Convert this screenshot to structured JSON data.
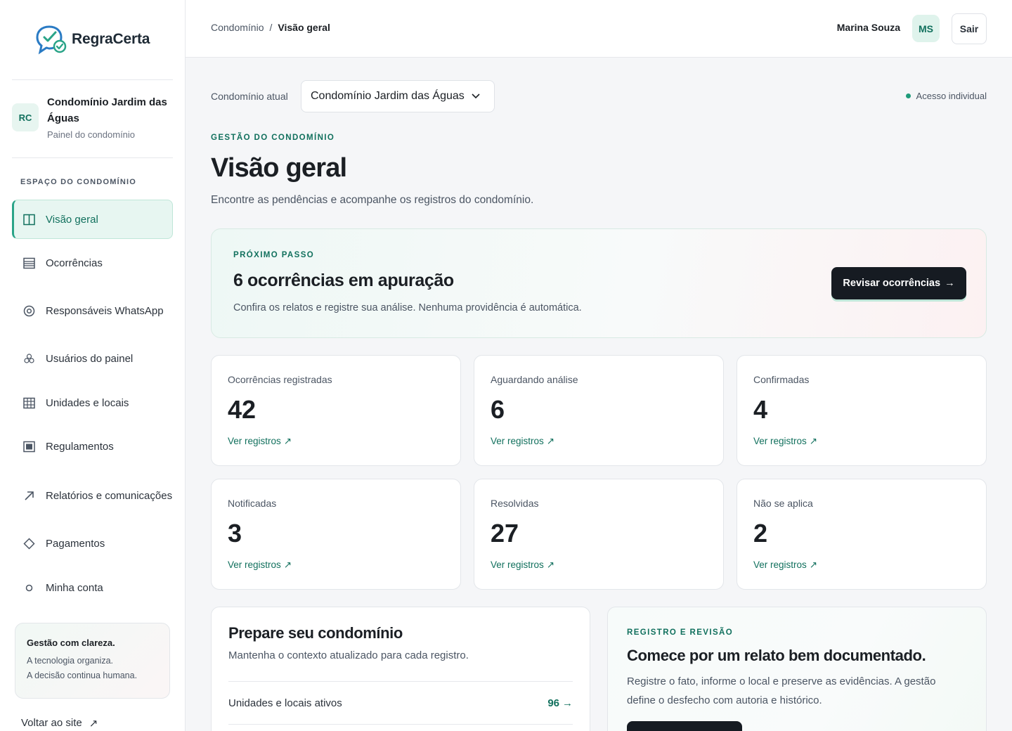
{
  "brand": {
    "name": "RegraCerta",
    "accent": "#11705d",
    "check_color": "#2aa488"
  },
  "condo": {
    "initials": "RC",
    "name": "Condomínio Jardim das Águas",
    "subtitle": "Painel do condomínio"
  },
  "sidebar": {
    "section_label": "ESPAÇO DO CONDOMÍNIO",
    "items": [
      {
        "label": "Visão geral",
        "icon": "columns-icon",
        "active": true
      },
      {
        "label": "Ocorrências",
        "icon": "list-icon"
      },
      {
        "label": "Responsáveis WhatsApp",
        "icon": "target-icon"
      },
      {
        "label": "Usuários do painel",
        "icon": "users-icon"
      },
      {
        "label": "Unidades e locais",
        "icon": "grid-icon"
      },
      {
        "label": "Regulamentos",
        "icon": "book-icon"
      },
      {
        "label": "Relatórios e comunicações",
        "icon": "arrow-up-right-icon"
      },
      {
        "label": "Pagamentos",
        "icon": "diamond-icon"
      },
      {
        "label": "Minha conta",
        "icon": "circle-icon"
      }
    ],
    "tip": {
      "title": "Gestão com clareza.",
      "line1": "A tecnologia organiza.",
      "line2": "A decisão continua humana."
    },
    "back_link": "Voltar ao site"
  },
  "topbar": {
    "breadcrumb": {
      "parent": "Condomínio",
      "separator": "/",
      "current": "Visão geral"
    },
    "user_name": "Marina Souza",
    "user_initials": "MS",
    "logout_label": "Sair"
  },
  "main": {
    "selector_label": "Condomínio atual",
    "selector_value": "Condomínio Jardim das Águas",
    "access_label": "Acesso individual",
    "eyebrow": "GESTÃO DO CONDOMÍNIO",
    "title": "Visão geral",
    "lead": "Encontre as pendências e acompanhe os registros do condomínio.",
    "next_step": {
      "eyebrow": "PRÓXIMO PASSO",
      "title": "6 ocorrências em apuração",
      "description": "Confira os relatos e registre sua análise. Nenhuma providência é automática.",
      "button": "Revisar ocorrências"
    },
    "stats": [
      {
        "label": "Ocorrências registradas",
        "value": "42",
        "link": "Ver registros"
      },
      {
        "label": "Aguardando análise",
        "value": "6",
        "link": "Ver registros"
      },
      {
        "label": "Confirmadas",
        "value": "4",
        "link": "Ver registros"
      },
      {
        "label": "Notificadas",
        "value": "3",
        "link": "Ver registros"
      },
      {
        "label": "Resolvidas",
        "value": "27",
        "link": "Ver registros"
      },
      {
        "label": "Não se aplica",
        "value": "2",
        "link": "Ver registros"
      }
    ],
    "prepare": {
      "title": "Prepare seu condomínio",
      "subtitle": "Mantenha o contexto atualizado para cada registro.",
      "rows": [
        {
          "label": "Unidades e locais ativos",
          "value": "96"
        }
      ]
    },
    "documented": {
      "eyebrow": "REGISTRO E REVISÃO",
      "title": "Comece por um relato bem documentado.",
      "description": "Registre o fato, informe o local e preserve as evidências. A gestão define o desfecho com autoria e histórico."
    }
  }
}
